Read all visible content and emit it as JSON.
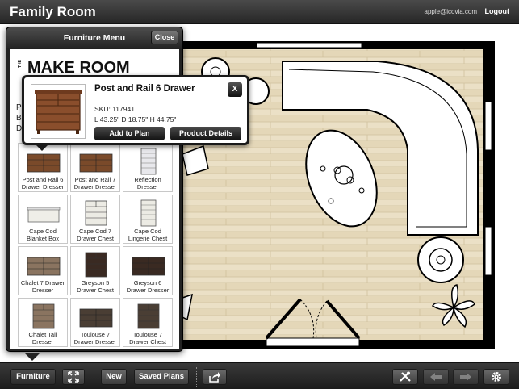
{
  "header": {
    "title": "Family Room",
    "user_email": "apple@icovia.com",
    "logout_label": "Logout"
  },
  "furniture_menu": {
    "title": "Furniture Menu",
    "close_label": "Close",
    "brand_small": "THE",
    "brand_name": "MAKE ROOM",
    "desc_fragments": [
      "P",
      "B",
      "D"
    ],
    "items": [
      {
        "label": "Post and Rail 6 Drawer Dresser",
        "icon": "dresser-wide-icon",
        "color": "#7a4a2a"
      },
      {
        "label": "Post and Rail 7 Drawer Dresser",
        "icon": "dresser-wide-icon",
        "color": "#7a4a2a"
      },
      {
        "label": "Reflection Dresser",
        "icon": "dresser-tall-icon",
        "color": "#e8e8ec"
      },
      {
        "label": "Cape Cod Blanket Box",
        "icon": "blanket-box-icon",
        "color": "#efeee8"
      },
      {
        "label": "Cape Cod 7 Drawer Chest",
        "icon": "chest-icon",
        "color": "#ecebe4"
      },
      {
        "label": "Cape Cod Lingerie Chest",
        "icon": "lingerie-chest-icon",
        "color": "#ecebe4"
      },
      {
        "label": "Chalet 7 Drawer Dresser",
        "icon": "dresser-wide-icon",
        "color": "#8a7460"
      },
      {
        "label": "Greyson 5 Drawer Chest",
        "icon": "chest-icon",
        "color": "#3a2a22"
      },
      {
        "label": "Greyson 6 Drawer Dresser",
        "icon": "dresser-wide-icon",
        "color": "#3a2a22"
      },
      {
        "label": "Chalet Tall Dresser",
        "icon": "chest-icon",
        "color": "#8a7460"
      },
      {
        "label": "Toulouse 7 Drawer Dresser",
        "icon": "dresser-wide-icon",
        "color": "#4a3e34"
      },
      {
        "label": "Toulouse 7 Drawer Chest",
        "icon": "chest-icon",
        "color": "#4a3e34"
      }
    ]
  },
  "product_detail": {
    "name": "Post and Rail 6 Drawer",
    "sku": "SKU: 117941",
    "dimensions": "L 43.25\" D 18.75\" H 44.75\"",
    "close_label": "X",
    "add_label": "Add to Plan",
    "details_label": "Product Details",
    "image_color": "#8a4e2c"
  },
  "toolbar": {
    "furniture_label": "Furniture",
    "new_label": "New",
    "saved_plans_label": "Saved Plans",
    "icons": [
      "fullscreen-icon",
      "share-icon",
      "tools-icon",
      "undo-icon",
      "redo-icon",
      "settings-icon"
    ]
  },
  "colors": {
    "wall": "#000000",
    "floor": "#e8dcc0",
    "bar": "#2e2e2e"
  }
}
